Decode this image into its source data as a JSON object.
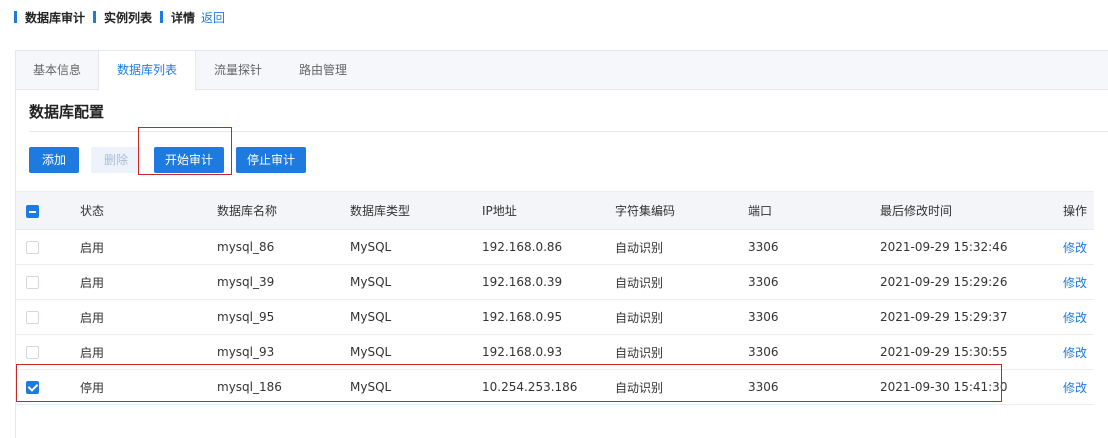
{
  "breadcrumb": {
    "items": [
      "数据库审计",
      "实例列表",
      "详情"
    ],
    "back": "返回"
  },
  "tabs": [
    {
      "label": "基本信息",
      "active": false
    },
    {
      "label": "数据库列表",
      "active": true
    },
    {
      "label": "流量探针",
      "active": false
    },
    {
      "label": "路由管理",
      "active": false
    }
  ],
  "section": {
    "title": "数据库配置"
  },
  "toolbar": {
    "add": "添加",
    "delete": "删除",
    "start_audit": "开始审计",
    "stop_audit": "停止审计"
  },
  "table": {
    "columns": [
      "状态",
      "数据库名称",
      "数据库类型",
      "IP地址",
      "字符集编码",
      "端口",
      "最后修改时间",
      "操作"
    ],
    "rows": [
      {
        "status": "启用",
        "name": "mysql_86",
        "type": "MySQL",
        "ip": "192.168.0.86",
        "charset": "自动识别",
        "port": "3306",
        "modified": "2021-09-29 15:32:46",
        "action": "修改",
        "checked": false
      },
      {
        "status": "启用",
        "name": "mysql_39",
        "type": "MySQL",
        "ip": "192.168.0.39",
        "charset": "自动识别",
        "port": "3306",
        "modified": "2021-09-29 15:29:26",
        "action": "修改",
        "checked": false
      },
      {
        "status": "启用",
        "name": "mysql_95",
        "type": "MySQL",
        "ip": "192.168.0.95",
        "charset": "自动识别",
        "port": "3306",
        "modified": "2021-09-29 15:29:37",
        "action": "修改",
        "checked": false
      },
      {
        "status": "启用",
        "name": "mysql_93",
        "type": "MySQL",
        "ip": "192.168.0.93",
        "charset": "自动识别",
        "port": "3306",
        "modified": "2021-09-29 15:30:55",
        "action": "修改",
        "checked": false
      },
      {
        "status": "停用",
        "name": "mysql_186",
        "type": "MySQL",
        "ip": "10.254.253.186",
        "charset": "自动识别",
        "port": "3306",
        "modified": "2021-09-30 15:41:30",
        "action": "修改",
        "checked": true
      }
    ]
  },
  "colors": {
    "accent": "#1f7ae0",
    "highlight": "#c62828"
  }
}
